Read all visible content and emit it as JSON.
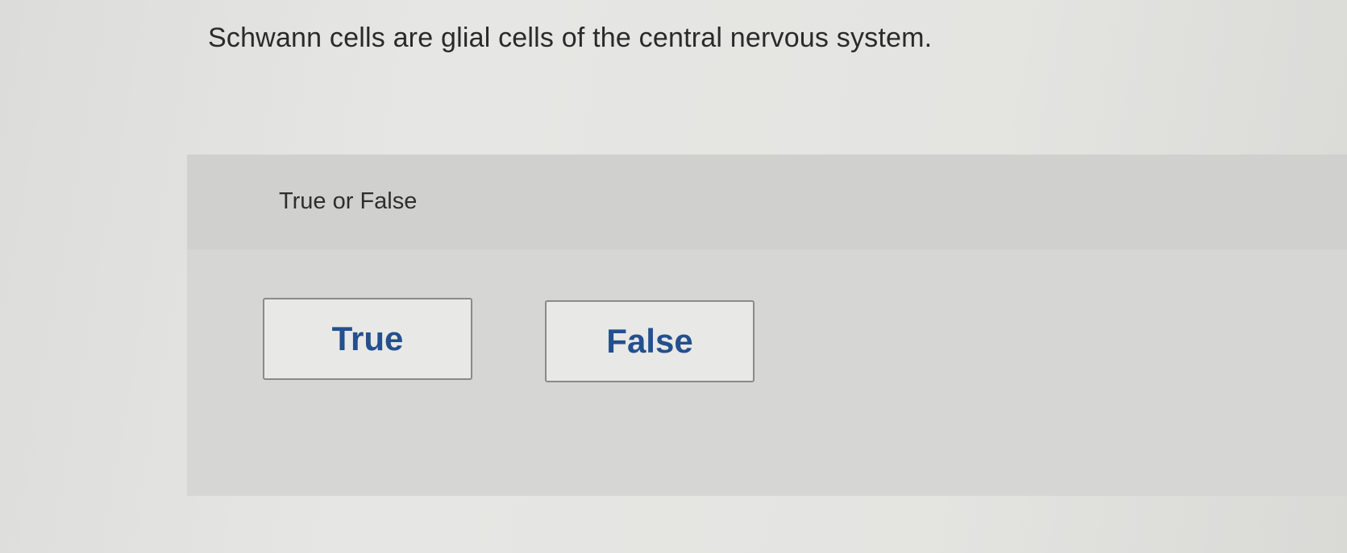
{
  "question": {
    "text": "Schwann cells are glial cells of the central nervous system."
  },
  "answer_panel": {
    "instruction": "True or False",
    "choices": [
      {
        "label": "True"
      },
      {
        "label": "False"
      }
    ]
  },
  "colors": {
    "choice_text": "#23508e",
    "choice_border": "#8a8a8a",
    "question_text": "#2a2a2a"
  }
}
